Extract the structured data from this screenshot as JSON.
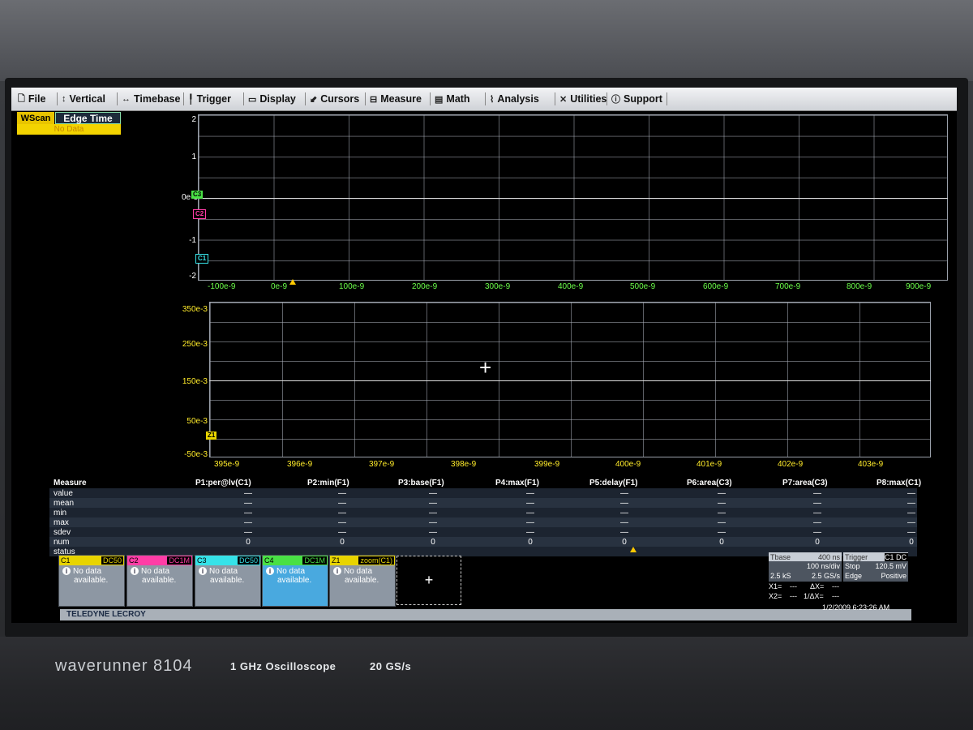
{
  "menu": {
    "items": [
      {
        "label": "File",
        "icon": "🗋"
      },
      {
        "label": "Vertical",
        "icon": "↕"
      },
      {
        "label": "Timebase",
        "icon": "↔"
      },
      {
        "label": "Trigger",
        "icon": "╿"
      },
      {
        "label": "Display",
        "icon": "▭"
      },
      {
        "label": "Cursors",
        "icon": "⬋"
      },
      {
        "label": "Measure",
        "icon": "⊟"
      },
      {
        "label": "Math",
        "icon": "▤"
      },
      {
        "label": "Analysis",
        "icon": "⌇"
      },
      {
        "label": "Utilities",
        "icon": "✕"
      },
      {
        "label": "Support",
        "icon": "ⓘ"
      }
    ]
  },
  "wscan": {
    "mode": "WScan",
    "param": "Edge Time",
    "status": "No Data"
  },
  "grid1": {
    "y_labels": [
      "2",
      "1",
      "0e-3",
      "-1",
      "-2"
    ],
    "x_labels": [
      "-100e-9",
      "0e-9",
      "100e-9",
      "200e-9",
      "300e-9",
      "400e-9",
      "500e-9",
      "600e-9",
      "700e-9",
      "800e-9",
      "900e-9"
    ],
    "tags": [
      "C3",
      "C2",
      "C1"
    ]
  },
  "grid2": {
    "y_labels": [
      "350e-3",
      "250e-3",
      "150e-3",
      "50e-3",
      "-50e-3"
    ],
    "x_labels": [
      "395e-9",
      "396e-9",
      "397e-9",
      "398e-9",
      "399e-9",
      "400e-9",
      "401e-9",
      "402e-9",
      "403e-9"
    ],
    "tag": "Z1",
    "crosshair": "+"
  },
  "measure": {
    "title": "Measure",
    "row_labels": [
      "value",
      "mean",
      "min",
      "max",
      "sdev",
      "num",
      "status"
    ],
    "columns": [
      {
        "name": "P1:per@lv(C1)",
        "dash": "—",
        "num": "0"
      },
      {
        "name": "P2:min(F1)",
        "dash": "—",
        "num": "0"
      },
      {
        "name": "P3:base(F1)",
        "dash": "—",
        "num": "0"
      },
      {
        "name": "P4:max(F1)",
        "dash": "—",
        "num": "0"
      },
      {
        "name": "P5:delay(F1)",
        "dash": "—",
        "num": "0"
      },
      {
        "name": "P6:area(C3)",
        "dash": "—",
        "num": "0"
      },
      {
        "name": "P7:area(C3)",
        "dash": "—",
        "num": "0"
      },
      {
        "name": "P8:max(C1)",
        "dash": "—",
        "num": "0"
      }
    ]
  },
  "channels": [
    {
      "name": "C1",
      "coupling": "DC50",
      "color": "#e8d400",
      "line1": "No data",
      "line2": "available."
    },
    {
      "name": "C2",
      "coupling": "DC1M",
      "color": "#ff3da6",
      "line1": "No data",
      "line2": "available."
    },
    {
      "name": "C3",
      "coupling": "DC50",
      "color": "#36e2e8",
      "line1": "No data",
      "line2": "available."
    },
    {
      "name": "C4",
      "coupling": "DC1M",
      "color": "#49e045",
      "line1": "No data",
      "line2": "available."
    },
    {
      "name": "Z1",
      "coupling": "zoom(C1)",
      "color": "#e8d400",
      "line1": "No data",
      "line2": "available."
    }
  ],
  "add_button": "+",
  "timebase": {
    "title": "Tbase",
    "offset": "400 ns",
    "per_div": "100 ns/div",
    "samples": "2.5 kS",
    "rate": "2.5 GS/s"
  },
  "trigger": {
    "title": "Trigger",
    "badges": "C1 DC",
    "mode": "Stop",
    "level": "120.5 mV",
    "type": "Edge",
    "slope": "Positive"
  },
  "cursors": {
    "x1": "X1=",
    "x1v": "---",
    "dx": "ΔX=",
    "dxv": "---",
    "x2": "X2=",
    "x2v": "---",
    "idx": "1/ΔX=",
    "idxv": "---"
  },
  "brand": "TELEDYNE LECROY",
  "datetime": "1/2/2009 6:23:26 AM",
  "bezel": {
    "model": "waverunner 8104",
    "spec1": "1 GHz Oscilloscope",
    "spec2": "20 GS/s"
  }
}
